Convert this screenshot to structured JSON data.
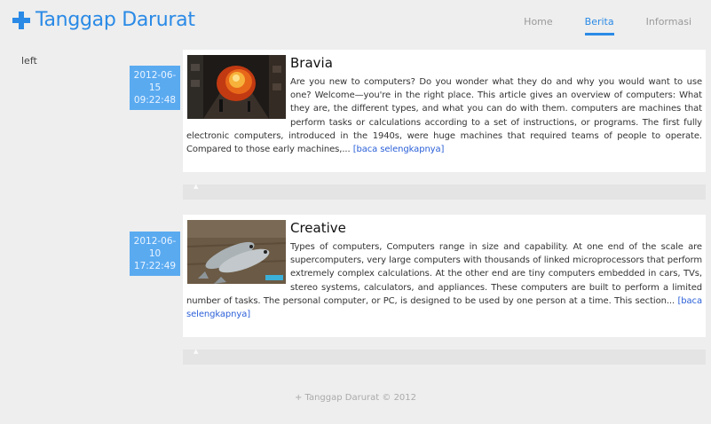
{
  "brand": {
    "title": "Tanggap Darurat",
    "icon": "plus-icon",
    "color": "#2a8ae6"
  },
  "nav": {
    "items": [
      {
        "label": "Home",
        "active": false
      },
      {
        "label": "Berita",
        "active": true
      },
      {
        "label": "Informasi",
        "active": false
      }
    ]
  },
  "sidebar": {
    "label": "left"
  },
  "posts": [
    {
      "date_day": "2012-06-",
      "date_num": "15",
      "date_time": "09:22:48",
      "title": "Bravia",
      "body": "Are you new to computers? Do you wonder what they do and why you would want to use one? Welcome—you're in the right place. This article gives an overview of computers: What they are,  the different types, and what you can do with them. computers are machines that perform tasks or calculations according to a set of instructions, or programs. The first fully electronic computers, introduced in the 1940s,  were huge machines that required teams of people to operate. Compared to those early machines,...",
      "read_more": "[baca selengkapnya]",
      "thumbnail": "fire-street-image"
    },
    {
      "date_day": "2012-06-",
      "date_num": "10",
      "date_time": "17:22:49",
      "title": "Creative",
      "body": "Types of computers, Computers range in size and capability. At one end of the scale are supercomputers, very large computers with thousands of linked microprocessors that perform extremely complex calculations. At the other end are tiny computers embedded in cars, TVs, stereo systems, calculators, and appliances. These computers are built to perform a limited number of tasks. The personal computer, or PC, is designed to be used by one person at a time. This section...",
      "read_more": "[baca selengkapnya]",
      "thumbnail": "fish-image"
    }
  ],
  "footer": {
    "text": "+ Tanggap Darurat © 2012"
  }
}
